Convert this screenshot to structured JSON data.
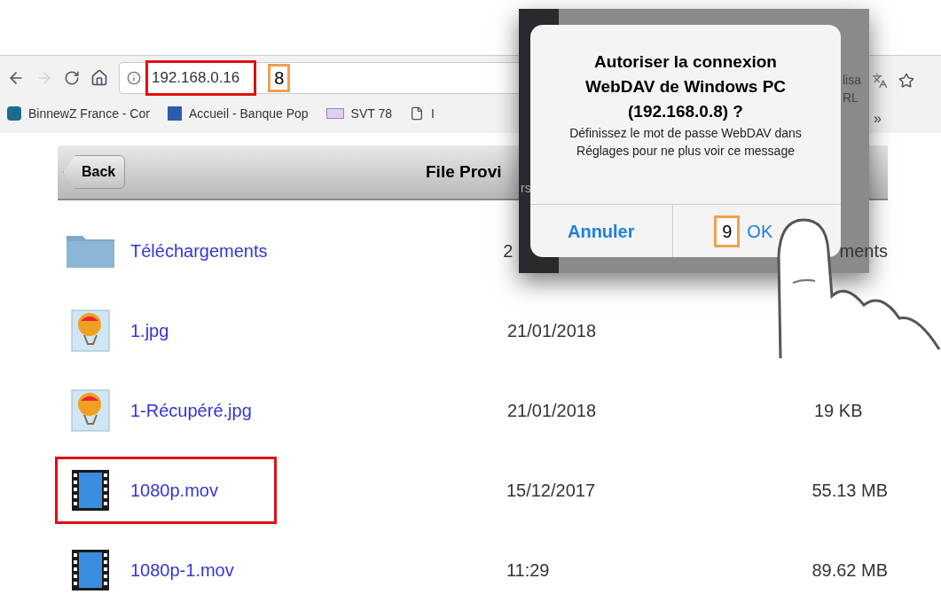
{
  "browser": {
    "address": "192.168.0.16",
    "address_highlighted": true,
    "step_badge": "8",
    "bookmarks": [
      {
        "label": "BinnewZ France - Cor",
        "kind": "logo"
      },
      {
        "label": "Accueil - Banque Pop",
        "kind": "bank"
      },
      {
        "label": "SVT 78",
        "kind": "logo2"
      },
      {
        "label": "I",
        "kind": "page"
      }
    ],
    "right_fragments": [
      "lisa",
      "RL"
    ],
    "overflow": "»"
  },
  "app": {
    "back": "Back",
    "title": "File Provi",
    "title_fragment": "rs",
    "files": [
      {
        "name": "Téléchargements",
        "kind": "folder",
        "date": "2",
        "size": "ments",
        "highlighted": false
      },
      {
        "name": "1.jpg",
        "kind": "image",
        "date": "21/01/2018",
        "highlighted": false
      },
      {
        "name": "1-Récupéré.jpg",
        "kind": "image",
        "date": "21/01/2018",
        "size": "19 KB",
        "highlighted": false
      },
      {
        "name": "1080p.mov",
        "kind": "video",
        "date": "15/12/2017",
        "size": "55.13 MB",
        "highlighted": true
      },
      {
        "name": "1080p-1.mov",
        "kind": "video",
        "date": "11:29",
        "size": "89.62 MB",
        "highlighted": false
      }
    ]
  },
  "dialog": {
    "title": "Autoriser la connexion WebDAV de Windows PC (192.168.0.8) ?",
    "message": "Définissez le mot de passe WebDAV dans Réglages pour ne plus voir ce message",
    "cancel": "Annuler",
    "ok": "OK",
    "step_badge": "9"
  }
}
